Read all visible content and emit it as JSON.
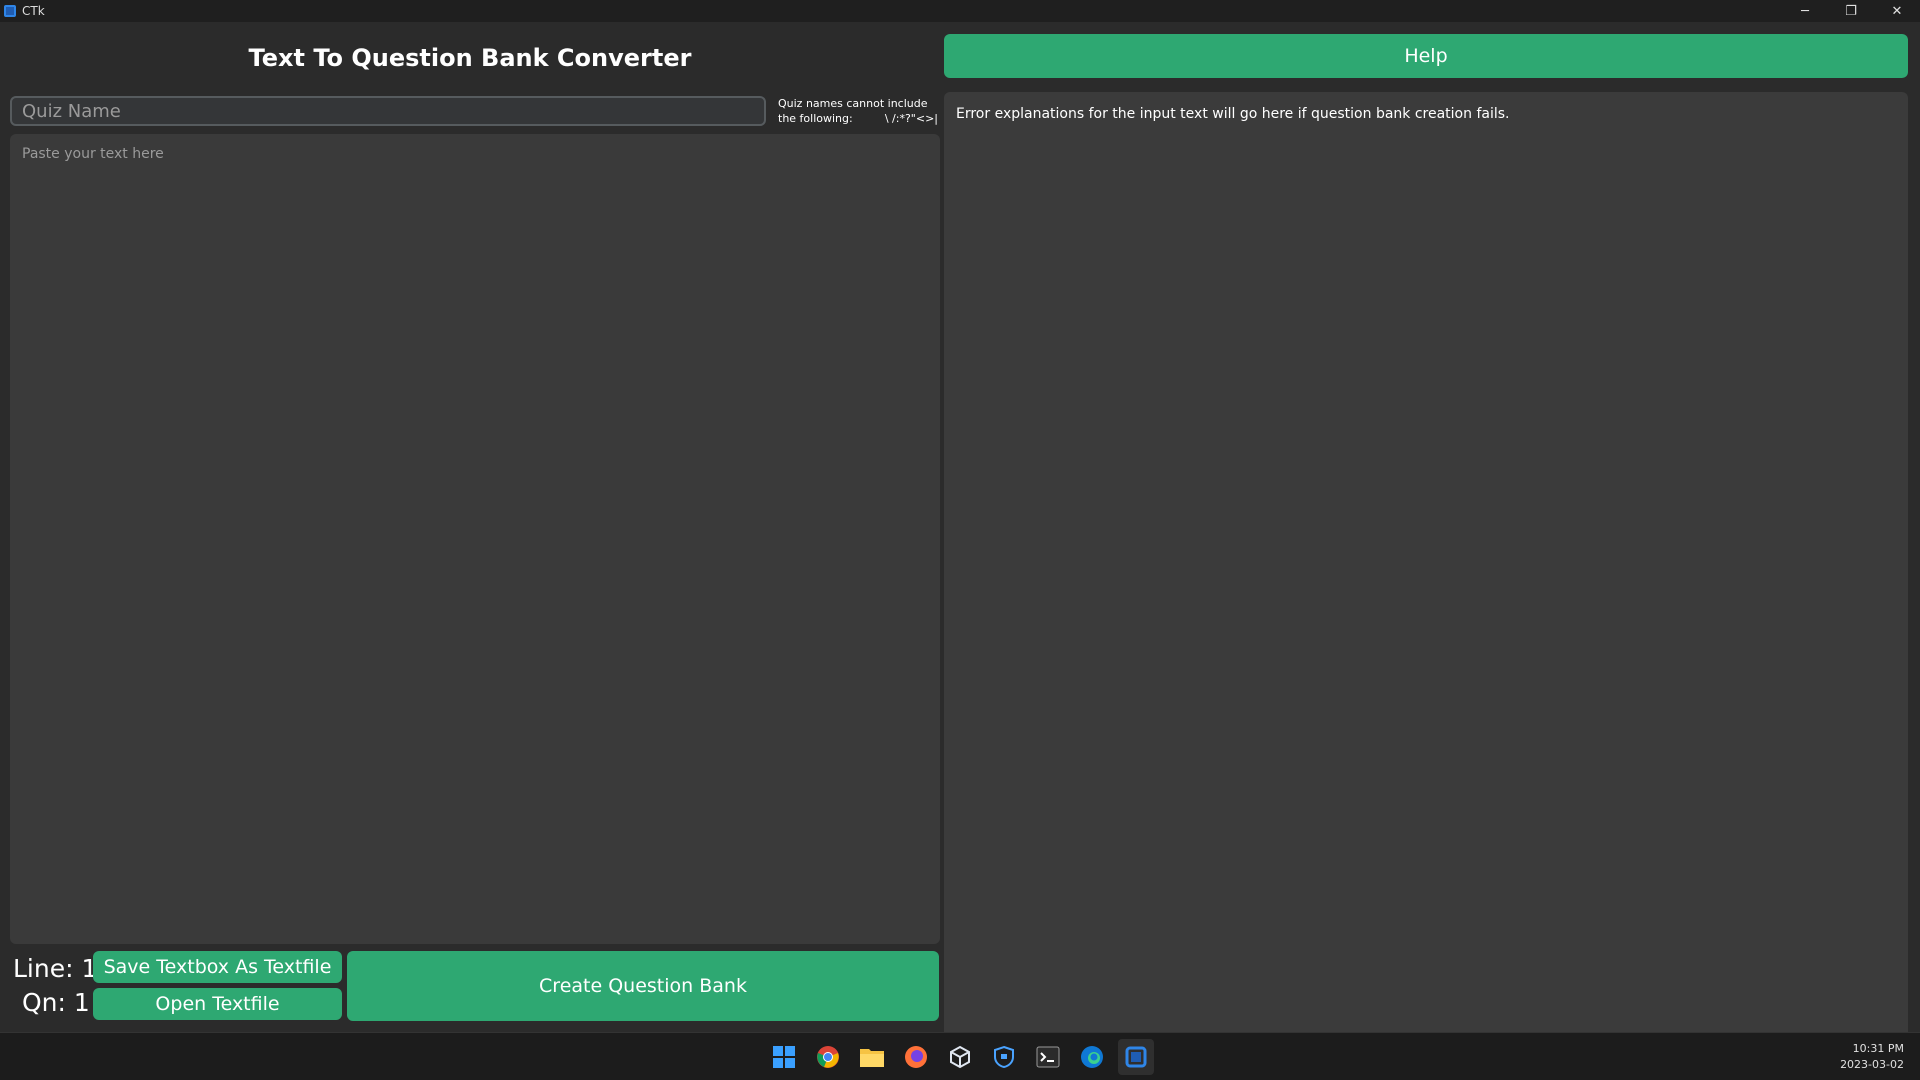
{
  "window": {
    "title": "CTk",
    "buttons": {
      "minimize": "─",
      "restore": "❐",
      "close": "✕"
    }
  },
  "app": {
    "title": "Text To Question Bank Converter",
    "help_label": "Help",
    "quiz_name_placeholder": "Quiz Name",
    "quiz_note_line1": "Quiz names cannot include",
    "quiz_note_line2_left": "the following:",
    "quiz_note_line2_right": "\\ /:*?\"<>|",
    "text_placeholder": "Paste your text here",
    "error_text": "Error explanations for the input text will go here if question bank creation fails.",
    "line_label": "Line: 1",
    "qn_label": "Qn: 1",
    "save_button_label": "Save Textbox As Textfile",
    "open_button_label": "Open Textfile",
    "create_button_label": "Create Question Bank"
  },
  "colors": {
    "background": "#2b2b2b",
    "panel": "#3a3a3a",
    "accent_green": "#2ea872",
    "titlebar": "#1f1f1f",
    "taskbar": "#1c1c1c"
  },
  "taskbar": {
    "icons": [
      "windows-start-icon",
      "chrome-icon",
      "file-explorer-icon",
      "firefox-icon",
      "virtualbox-icon",
      "security-shield-icon",
      "terminal-icon",
      "edge-icon",
      "ctk-app-icon"
    ],
    "time": "10:31 PM",
    "date": "2023-03-02"
  }
}
